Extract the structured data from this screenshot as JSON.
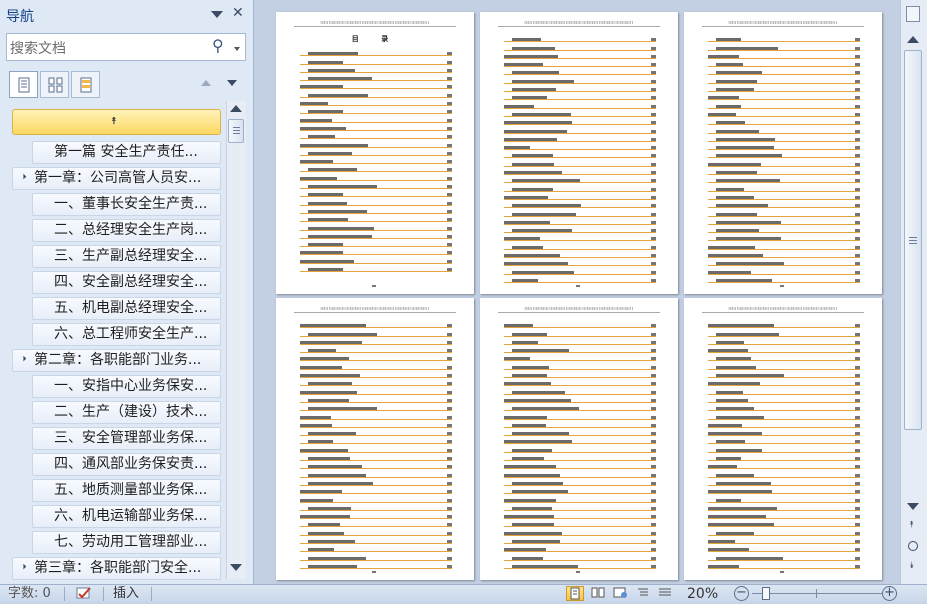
{
  "nav": {
    "title": "导航",
    "search_placeholder": "搜索文档",
    "tabs": [
      {
        "name": "headings-tab",
        "active": true
      },
      {
        "name": "pages-tab",
        "active": false
      },
      {
        "name": "results-tab",
        "active": false
      }
    ],
    "items": [
      {
        "label": "第一篇 安全生产责任...",
        "level": 2,
        "expandable": false
      },
      {
        "label": "第一章：公司高管人员安...",
        "level": 1,
        "expandable": true
      },
      {
        "label": "一、董事长安全生产责...",
        "level": 2,
        "expandable": false
      },
      {
        "label": "二、总经理安全生产岗...",
        "level": 2,
        "expandable": false
      },
      {
        "label": "三、生产副总经理安全...",
        "level": 2,
        "expandable": false
      },
      {
        "label": "四、安全副总经理安全...",
        "level": 2,
        "expandable": false
      },
      {
        "label": "五、机电副总经理安全...",
        "level": 2,
        "expandable": false
      },
      {
        "label": "六、总工程师安全生产...",
        "level": 2,
        "expandable": false
      },
      {
        "label": "第二章：各职能部门业务...",
        "level": 1,
        "expandable": true
      },
      {
        "label": "一、安指中心业务保安...",
        "level": 2,
        "expandable": false
      },
      {
        "label": "二、生产（建设）技术...",
        "level": 2,
        "expandable": false
      },
      {
        "label": "三、安全管理部业务保...",
        "level": 2,
        "expandable": false
      },
      {
        "label": "四、通风部业务保安责...",
        "level": 2,
        "expandable": false
      },
      {
        "label": "五、地质测量部业务保...",
        "level": 2,
        "expandable": false
      },
      {
        "label": "六、机电运输部业务保...",
        "level": 2,
        "expandable": false
      },
      {
        "label": "七、劳动用工管理部业...",
        "level": 2,
        "expandable": false
      },
      {
        "label": "第三章：各职能部门安全...",
        "level": 1,
        "expandable": true
      }
    ]
  },
  "document": {
    "toc_title": "目 录"
  },
  "status": {
    "word_count": "字数: 0",
    "insert_mode": "插入",
    "zoom": "20%",
    "accent": "#f6c446"
  }
}
